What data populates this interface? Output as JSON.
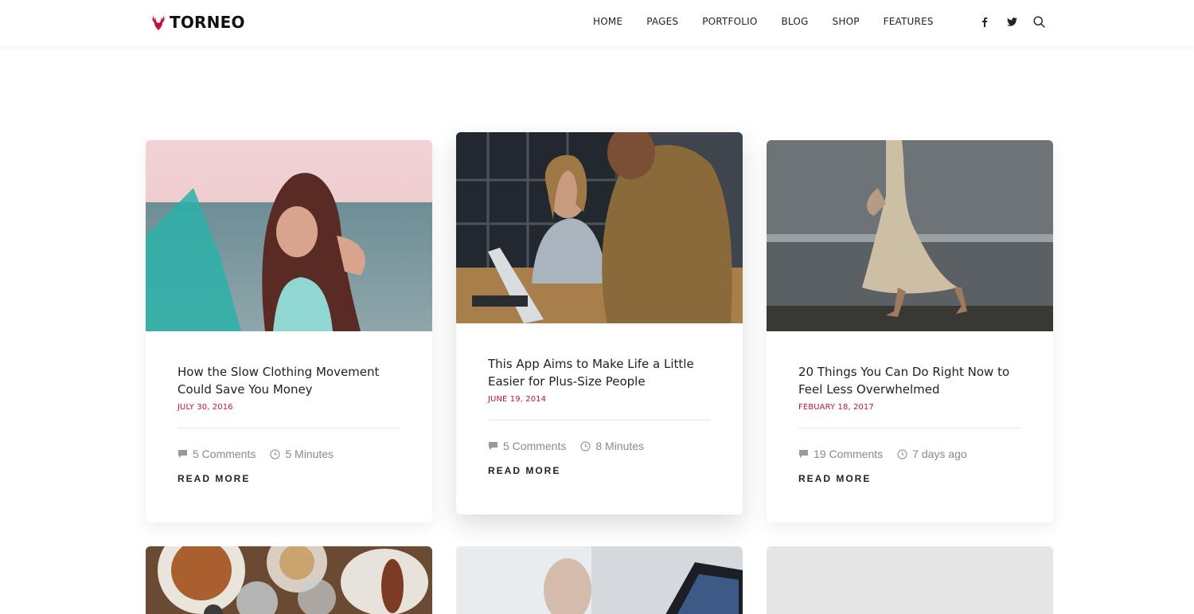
{
  "brand": {
    "name": "TORNEO",
    "accent": "#c0143c"
  },
  "nav": [
    "HOME",
    "PAGES",
    "PORTFOLIO",
    "BLOG",
    "SHOP",
    "FEATURES"
  ],
  "social": [
    "facebook-icon",
    "twitter-icon",
    "search-icon"
  ],
  "posts": [
    {
      "title": "How the Slow Clothing Movement Could Save You Money",
      "date": "JULY 30, 2016",
      "comments": "5 Comments",
      "time": "5 Minutes",
      "read_more": "READ MORE"
    },
    {
      "title": "This App Aims to Make Life a Little Easier for Plus-Size People",
      "date": "JUNE 19, 2014",
      "comments": "5 Comments",
      "time": "8 Minutes",
      "read_more": "READ MORE"
    },
    {
      "title": "20 Things You Can Do Right Now to Feel Less Overwhelmed",
      "date": "FEBUARY 18, 2017",
      "comments": "19 Comments",
      "time": "7 days ago",
      "read_more": "READ MORE"
    }
  ]
}
